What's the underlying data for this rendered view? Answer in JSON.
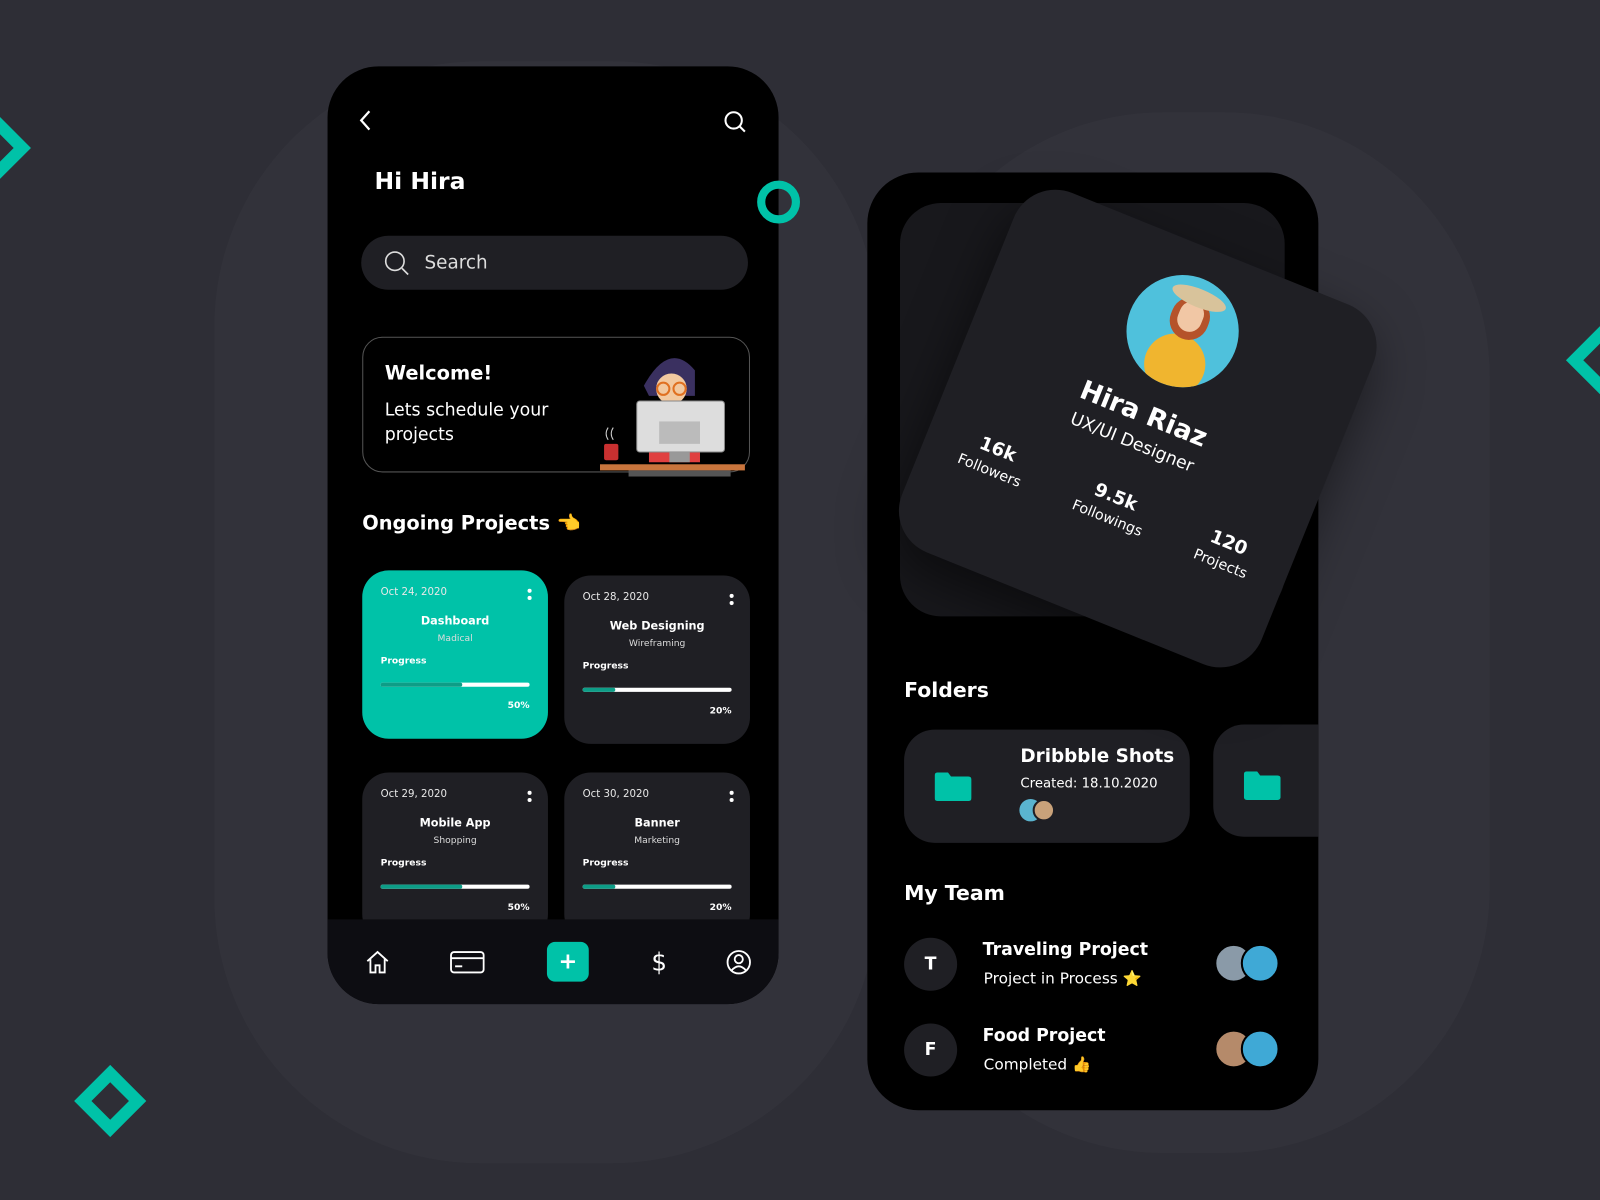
{
  "colors": {
    "accent": "#00c2a8",
    "background": "#2e2e36",
    "card": "#1f1f24"
  },
  "home": {
    "greeting": "Hi Hira",
    "search": {
      "placeholder": "Search"
    },
    "welcome": {
      "title": "Welcome!",
      "text": "Lets schedule your projects"
    },
    "section_title": "Ongoing Projects",
    "section_emoji": "👈",
    "projects": [
      {
        "date": "Oct 24, 2020",
        "title": "Dashboard",
        "subtitle": "Madical",
        "progress_label": "Progress",
        "progress": 50,
        "progress_text": "50%",
        "active": true
      },
      {
        "date": "Oct 28, 2020",
        "title": "Web Designing",
        "subtitle": "Wireframing",
        "progress_label": "Progress",
        "progress": 20,
        "progress_text": "20%",
        "active": false
      },
      {
        "date": "Oct 29, 2020",
        "title": "Mobile App",
        "subtitle": "Shopping",
        "progress_label": "Progress",
        "progress": 50,
        "progress_text": "50%",
        "active": false
      },
      {
        "date": "Oct 30, 2020",
        "title": "Banner",
        "subtitle": "Marketing",
        "progress_label": "Progress",
        "progress": 20,
        "progress_text": "20%",
        "active": false
      }
    ],
    "nav": [
      "home-icon",
      "card-icon",
      "plus-icon",
      "dollar-icon",
      "profile-icon"
    ]
  },
  "profile": {
    "name": "Hira Riaz",
    "role": "UX/UI Designer",
    "stats": [
      {
        "value": "16k",
        "label": "Followers"
      },
      {
        "value": "9.5k",
        "label": "Followings"
      },
      {
        "value": "120",
        "label": "Projects"
      }
    ],
    "folders_title": "Folders",
    "folders": [
      {
        "name": "Dribbble Shots",
        "created": "Created: 18.10.2020"
      }
    ],
    "team_title": "My Team",
    "team": [
      {
        "letter": "T",
        "name": "Traveling Project",
        "status": "Project in Process",
        "emoji": "⭐"
      },
      {
        "letter": "F",
        "name": "Food Project",
        "status": "Completed",
        "emoji": "👍"
      }
    ]
  }
}
